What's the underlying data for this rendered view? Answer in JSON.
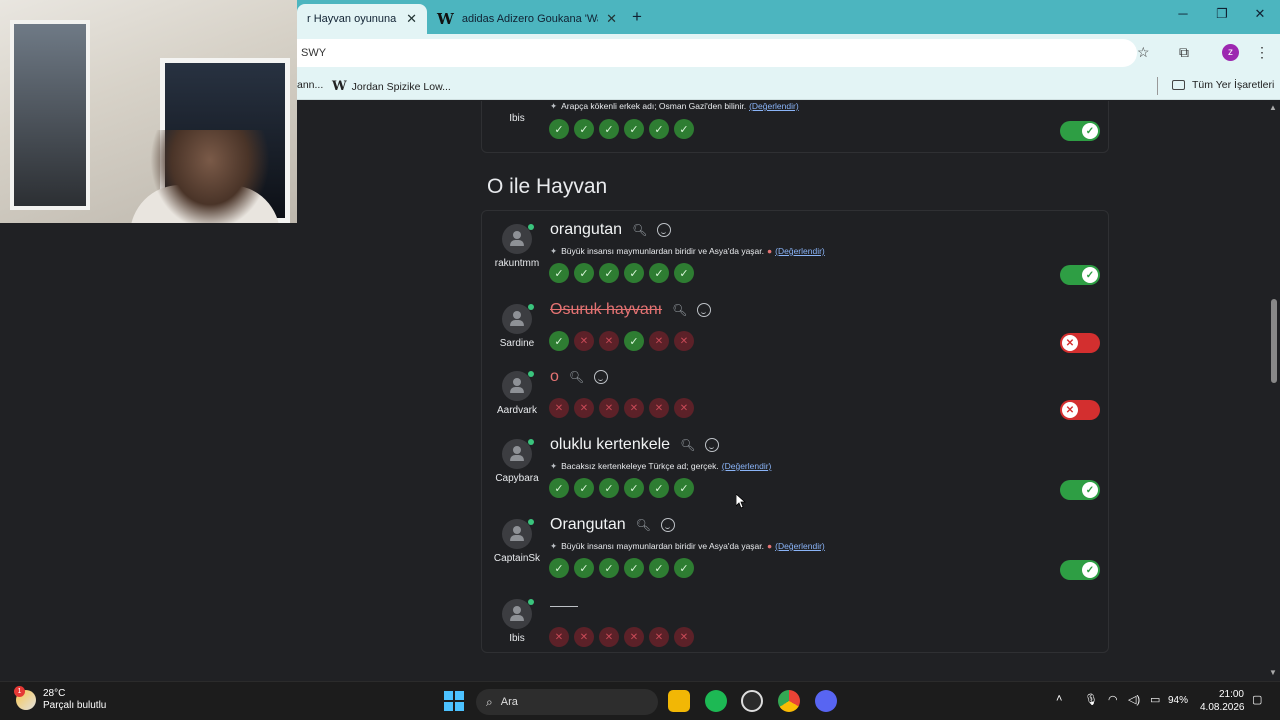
{
  "browser": {
    "tabs": [
      {
        "title": "r Hayvan oyununa katı",
        "favicon": "",
        "active": true
      },
      {
        "title": "adidas Adizero Goukana 'Warm",
        "favicon": "W",
        "active": false
      }
    ],
    "new_tab_label": "+",
    "url": "SWY",
    "bookmarks": [
      {
        "label": "ann...",
        "favicon": ""
      },
      {
        "label": "Jordan Spizike Low...",
        "favicon": "W"
      }
    ],
    "all_bookmarks_label": "Tüm Yer İşaretleri",
    "profile_initial": "z"
  },
  "page": {
    "top_entry": {
      "username": "Ibis",
      "desc": "Arapça kökenli erkek adı; Osman Gazi'den bilinir.",
      "rate_label": "(Değerlendir)",
      "votes": [
        "ok",
        "ok",
        "ok",
        "ok",
        "ok",
        "ok"
      ],
      "toggle": "on"
    },
    "section_title": "O ile Hayvan",
    "entries": [
      {
        "username": "rakuntmm",
        "word": "orangutan",
        "style": "normal",
        "desc": "Büyük insansı maymunlardan biridir ve Asya'da yaşar.",
        "warn": "●",
        "rate_label": "(Değerlendir)",
        "votes": [
          "ok",
          "ok",
          "ok",
          "ok",
          "ok",
          "ok"
        ],
        "toggle": "on"
      },
      {
        "username": "Sardine",
        "word": "Osuruk hayvanı",
        "style": "strike",
        "desc": "",
        "warn": "",
        "rate_label": "",
        "votes": [
          "ok",
          "no",
          "no",
          "ok",
          "no",
          "no"
        ],
        "toggle": "off"
      },
      {
        "username": "Aardvark",
        "word": "o",
        "style": "red",
        "desc": "",
        "warn": "",
        "rate_label": "",
        "votes": [
          "no",
          "no",
          "no",
          "no",
          "no",
          "no"
        ],
        "toggle": "off"
      },
      {
        "username": "Capybara",
        "word": "oluklu kertenkele",
        "style": "normal",
        "desc": "Bacaksız kertenkeleye Türkçe ad; gerçek.",
        "warn": "",
        "rate_label": "(Değerlendir)",
        "votes": [
          "ok",
          "ok",
          "ok",
          "ok",
          "ok",
          "ok"
        ],
        "toggle": "on"
      },
      {
        "username": "CaptainSk",
        "word": "Orangutan",
        "style": "normal",
        "desc": "Büyük insansı maymunlardan biridir ve Asya'da yaşar.",
        "warn": "●",
        "rate_label": "(Değerlendir)",
        "votes": [
          "ok",
          "ok",
          "ok",
          "ok",
          "ok",
          "ok"
        ],
        "toggle": "on"
      },
      {
        "username": "Ibis",
        "word": "",
        "style": "dash",
        "desc": "",
        "warn": "",
        "rate_label": "",
        "votes": [
          "no",
          "no",
          "no",
          "no",
          "no",
          "no"
        ],
        "toggle": "none"
      }
    ],
    "icons": {
      "ok": "✓",
      "no": "✕",
      "search": "search-icon",
      "emoji": "add-reaction-icon",
      "spark": "sparkle-icon"
    }
  },
  "taskbar": {
    "weather_temp": "28°C",
    "weather_desc": "Parçalı bulutlu",
    "weather_badge": "1",
    "search_label": "Ara",
    "battery": "94%",
    "time": "21:00",
    "date": "4.08.2026"
  }
}
